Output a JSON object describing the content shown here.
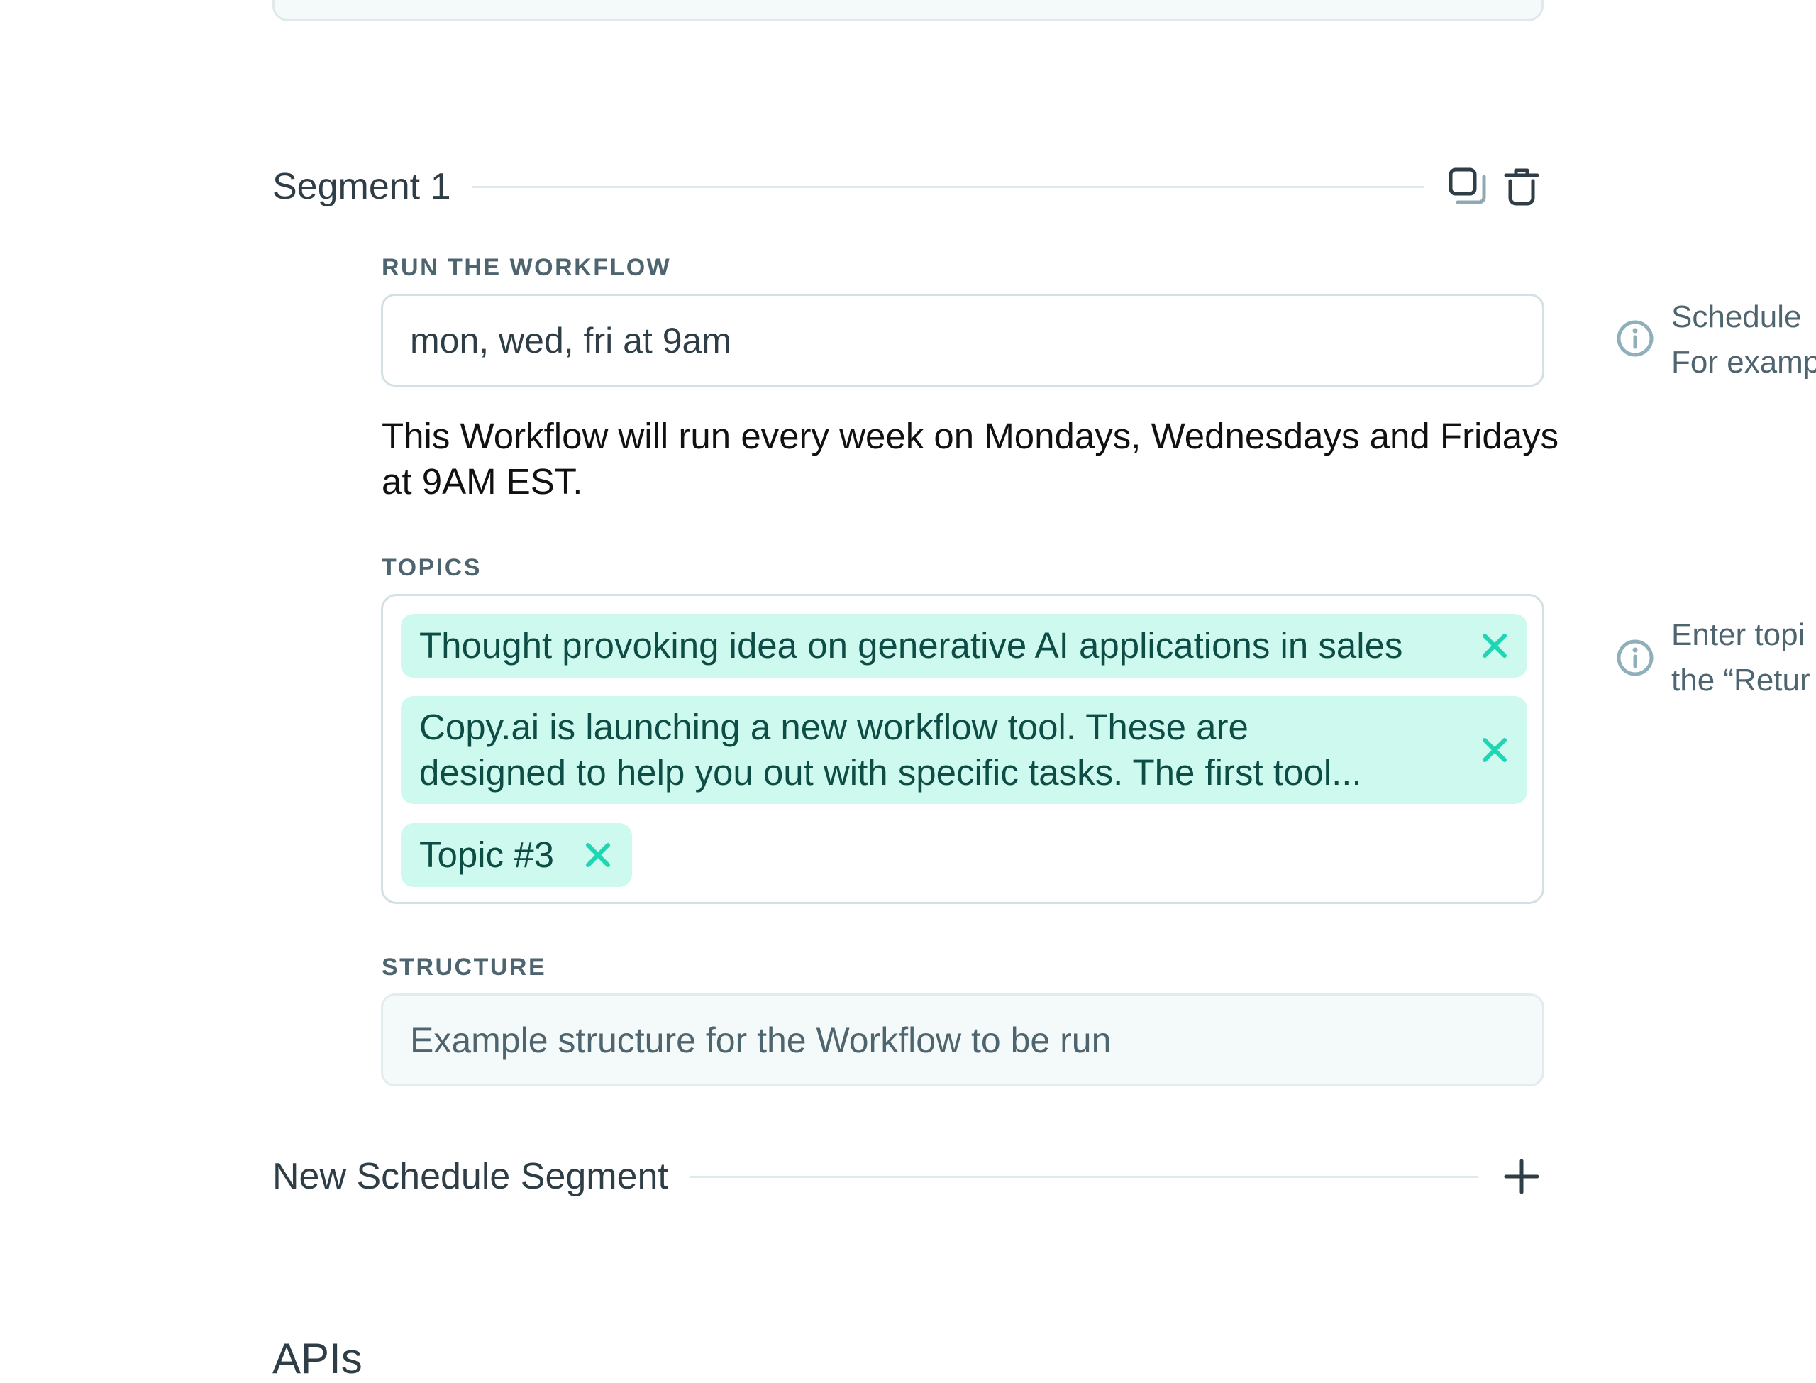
{
  "segment": {
    "title": "Segment 1",
    "duplicate_icon": "duplicate-icon",
    "delete_icon": "trash-icon"
  },
  "run_workflow": {
    "label": "RUN THE WORKFLOW",
    "value": "mon, wed, fri at 9am",
    "description": "This Workflow will run every week on Mondays, Wednesdays and Fridays at 9AM EST.",
    "hint_line1": "Schedule",
    "hint_line2": "For examp"
  },
  "topics": {
    "label": "TOPICS",
    "chips": [
      {
        "text": "Thought provoking idea on generative AI applications in sales"
      },
      {
        "line1": "Copy.ai is launching a new workflow tool. These are",
        "line2": "designed to help you out with specific tasks. The first tool..."
      },
      {
        "text": "Topic #3"
      }
    ],
    "hint_line1": "Enter topi",
    "hint_line2": "the “Retur"
  },
  "structure": {
    "label": "STRUCTURE",
    "placeholder": "Example structure for the Workflow to be run"
  },
  "new_segment": {
    "label": "New Schedule Segment",
    "icon": "plus-icon"
  },
  "next_section": {
    "title": "APIs"
  },
  "colors": {
    "accent": "#1fd6b3",
    "chip_bg": "#cdf9ef",
    "chip_text": "#0d4d45",
    "muted_text": "#4e6570",
    "border": "#d3e0e4"
  }
}
